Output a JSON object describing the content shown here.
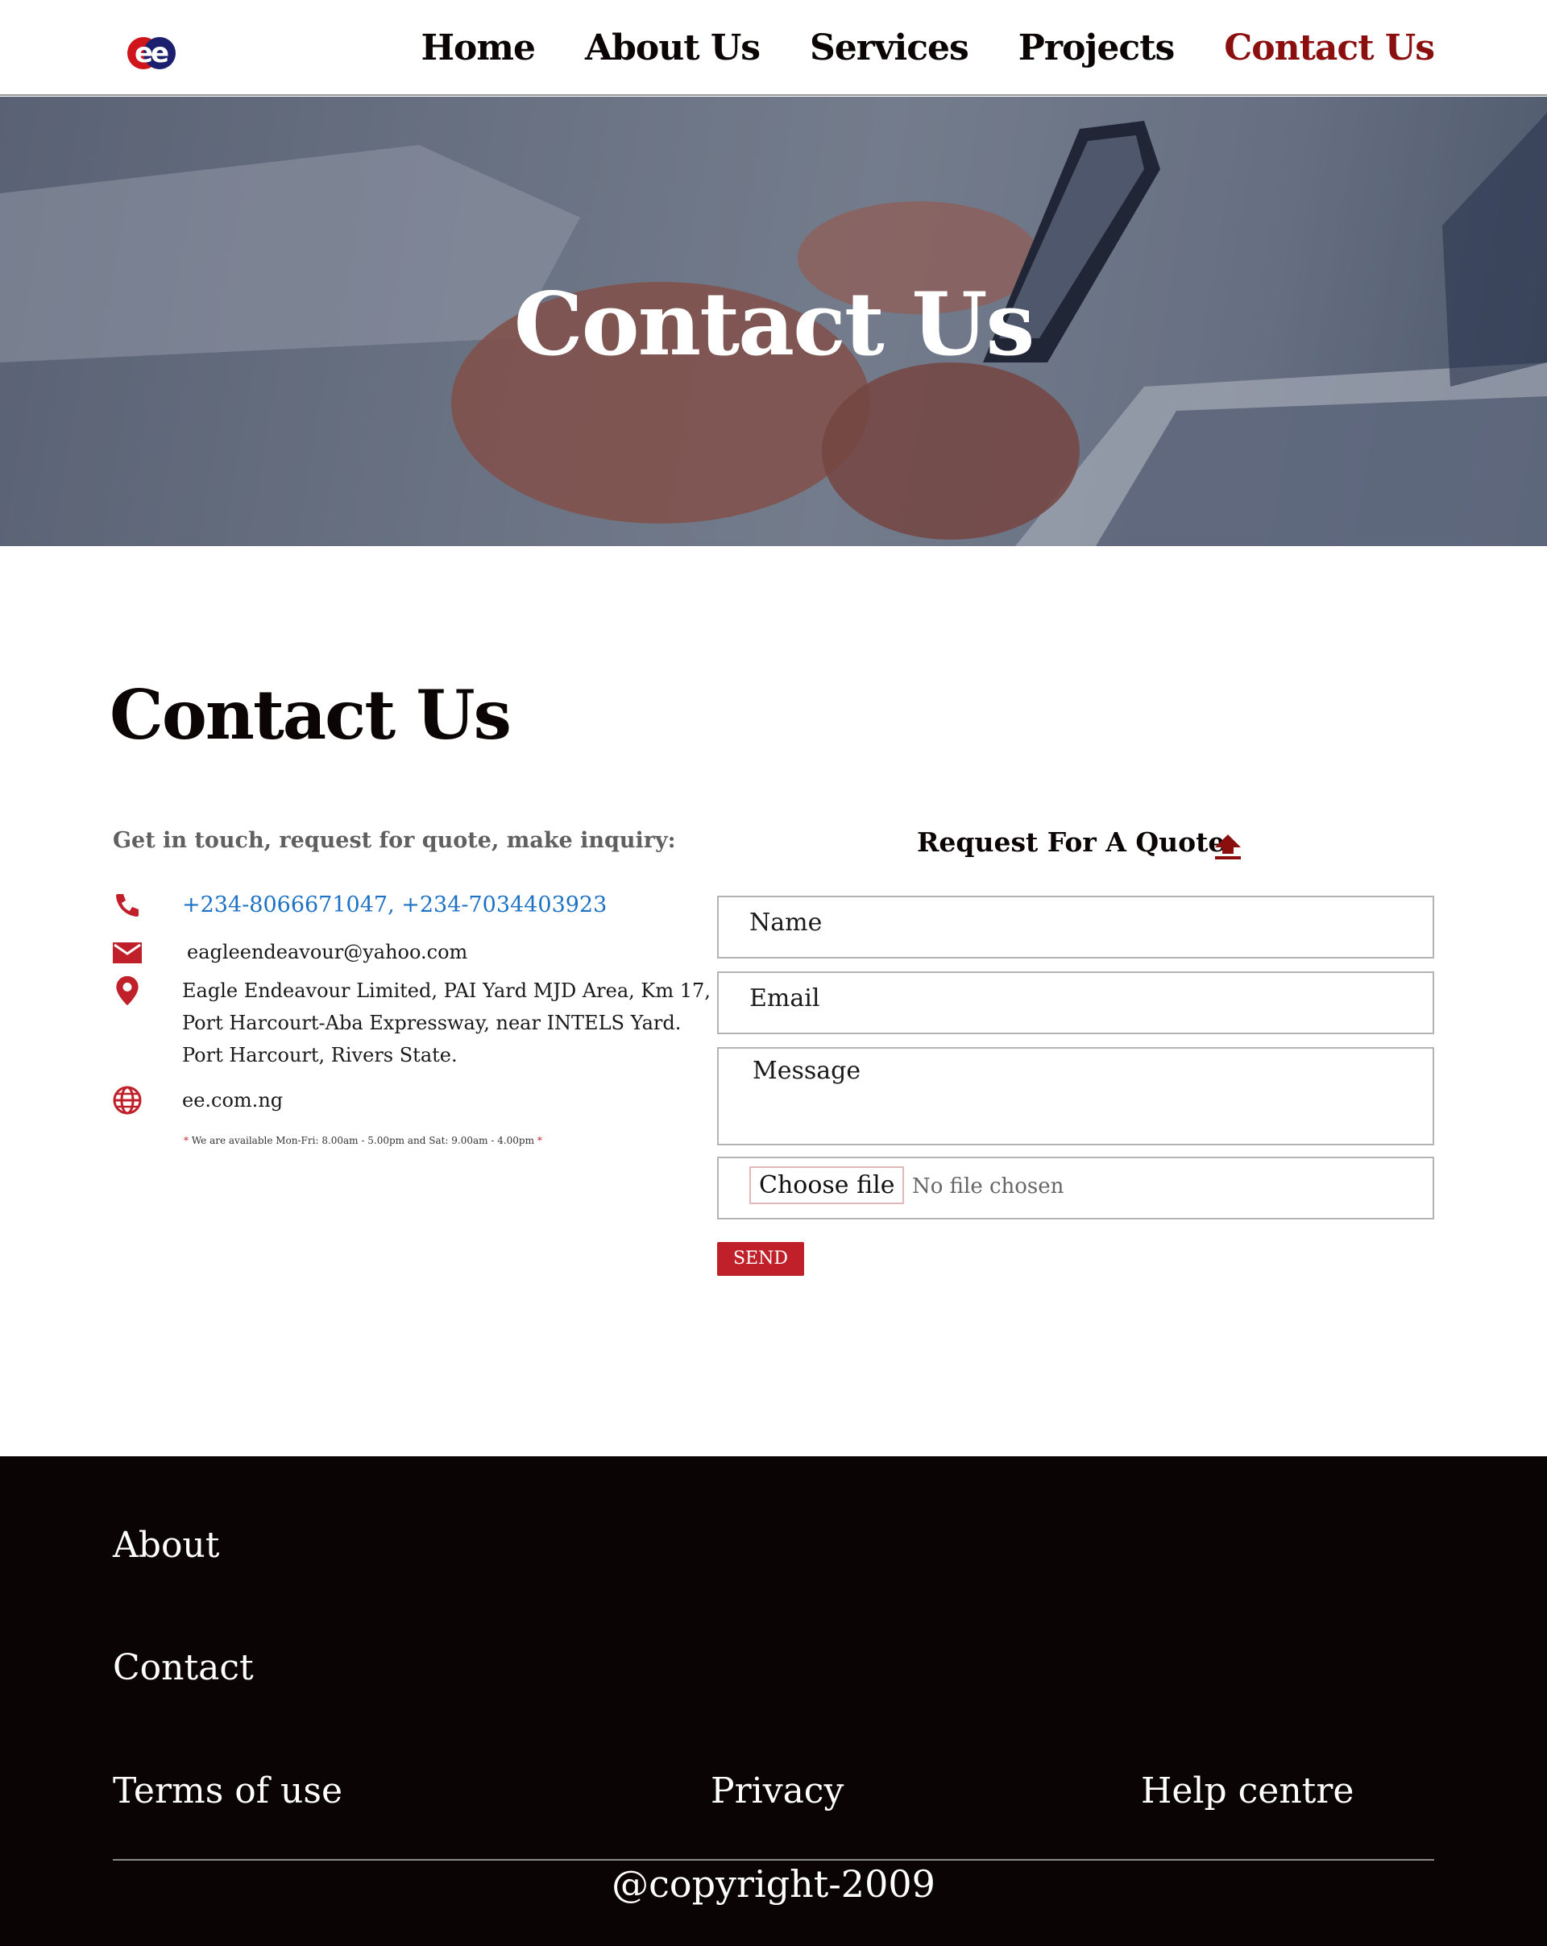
{
  "colors": {
    "accent": "#8c0f0f",
    "button": "#c0202a",
    "link": "#1d72c4",
    "footer_bg": "#0b0404"
  },
  "header": {
    "logo_icon": "ee-logo",
    "nav": [
      {
        "label": "Home"
      },
      {
        "label": "About Us"
      },
      {
        "label": "Services"
      },
      {
        "label": "Projects"
      },
      {
        "label": "Contact Us",
        "active": true
      }
    ]
  },
  "hero": {
    "title": "Contact Us"
  },
  "main": {
    "title": "Contact Us",
    "intro": "Get in touch, request for quote, make inquiry:",
    "contact": {
      "phone": "+234-8066671047, +234-7034403923",
      "email": "eagleendeavour@yahoo.com",
      "address_lines": [
        "Eagle Endeavour Limited, PAI Yard MJD Area, Km 17,",
        "Port Harcourt-Aba Expressway, near INTELS Yard.",
        "Port Harcourt, Rivers State."
      ],
      "website": "ee.com.ng",
      "availability": "We are available Mon-Fri: 8.00am - 5.00pm and Sat: 9.00am - 4.00pm"
    },
    "quote_form": {
      "title": "Request For A Quote",
      "name_placeholder": "Name",
      "email_placeholder": "Email",
      "message_placeholder": "Message",
      "file_button": "Choose file",
      "file_status": "No file chosen",
      "send_label": "SEND"
    }
  },
  "footer": {
    "about": "About",
    "contact": "Contact",
    "terms": "Terms of use",
    "privacy": "Privacy",
    "help": "Help centre",
    "copyright": "@copyright-2009"
  }
}
